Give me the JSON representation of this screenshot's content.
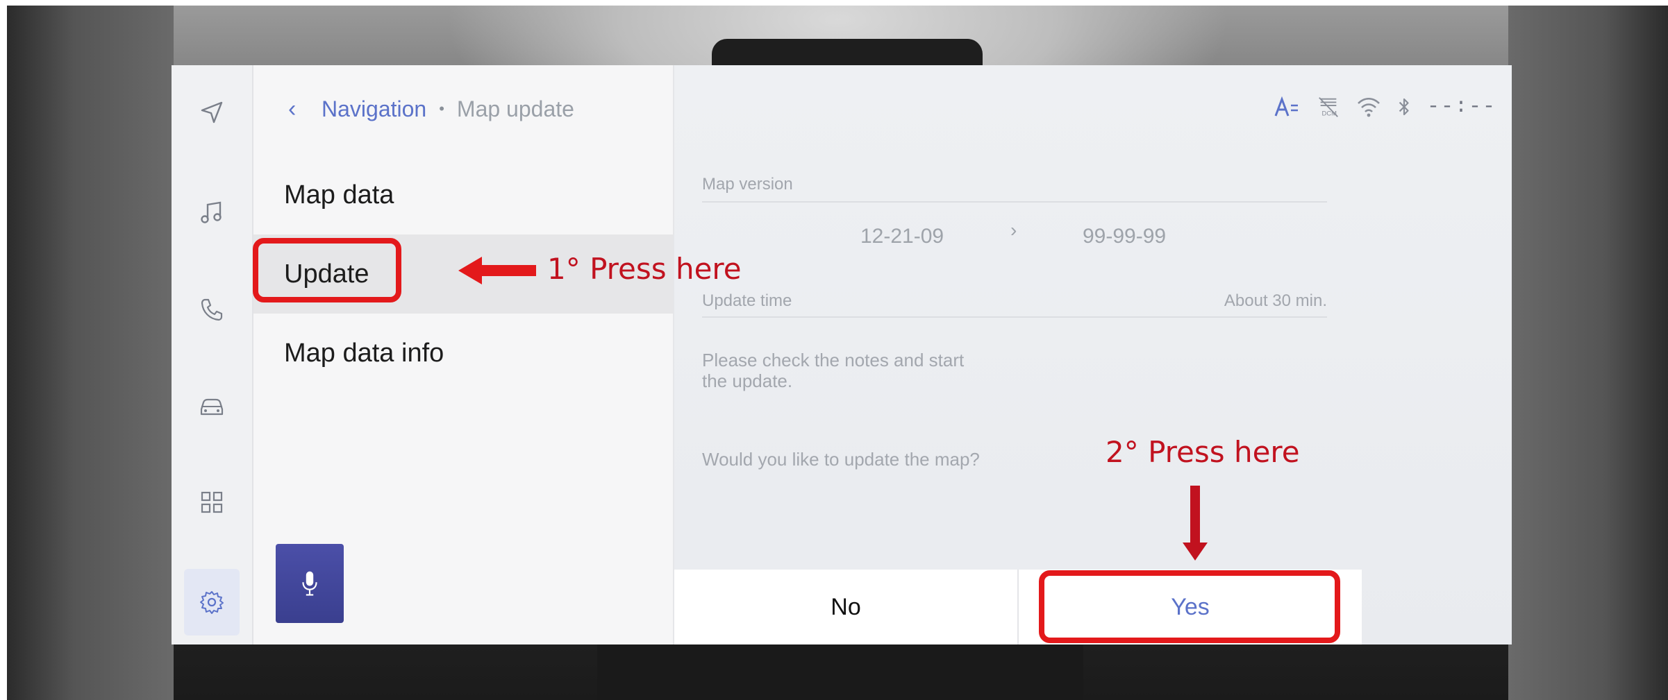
{
  "breadcrumb": {
    "parent": "Navigation",
    "current": "Map update",
    "separator": "•",
    "back_glyph": "‹"
  },
  "menu": [
    {
      "label": "Map data"
    },
    {
      "label": "Update"
    },
    {
      "label": "Map data info"
    }
  ],
  "rail": [
    "navigation-icon",
    "music-icon",
    "phone-icon",
    "car-icon",
    "apps-icon",
    "settings-icon"
  ],
  "status": {
    "clock": "--:--"
  },
  "details": {
    "map_version_label": "Map version",
    "current_version": "12-21-09",
    "version_arrow": "›",
    "new_version": "99-99-99",
    "update_time_label": "Update time",
    "update_time_value": "About 30 min.",
    "note_text": "Please check the notes and start the update.",
    "question": "Would you like to update the map?"
  },
  "buttons": {
    "no": "No",
    "yes": "Yes"
  },
  "annotations": {
    "step1": "1° Press here",
    "step2": "2° Press here"
  },
  "colors": {
    "accent": "#5b72c9",
    "highlight": "#e3191b",
    "annotation_text": "#c1121f",
    "mic": "#3f4496"
  }
}
